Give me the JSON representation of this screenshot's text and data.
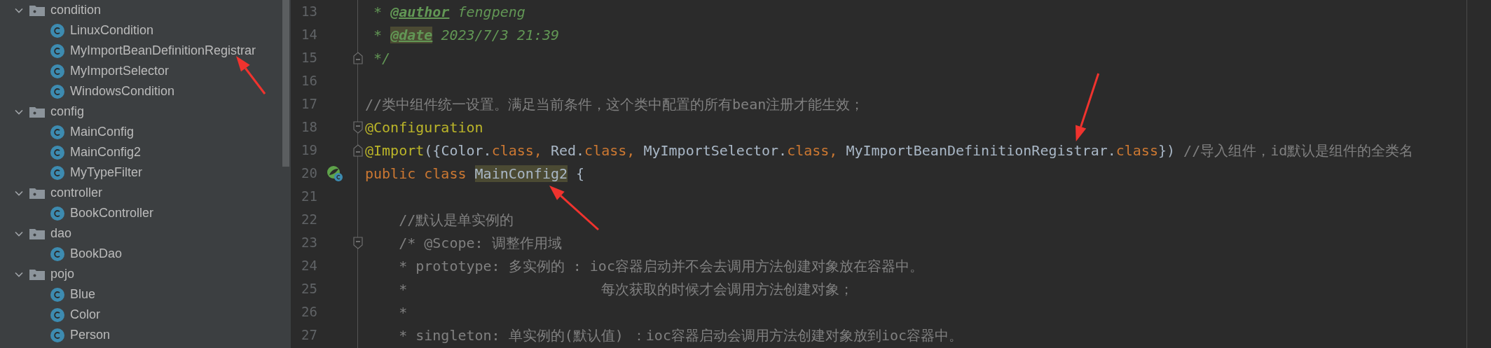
{
  "project_tree": [
    {
      "name": "condition",
      "kind": "package",
      "expanded": true,
      "children": [
        {
          "name": "LinuxCondition",
          "kind": "class"
        },
        {
          "name": "MyImportBeanDefinitionRegistrar",
          "kind": "class"
        },
        {
          "name": "MyImportSelector",
          "kind": "class"
        },
        {
          "name": "WindowsCondition",
          "kind": "class"
        }
      ]
    },
    {
      "name": "config",
      "kind": "package",
      "expanded": true,
      "children": [
        {
          "name": "MainConfig",
          "kind": "class"
        },
        {
          "name": "MainConfig2",
          "kind": "class"
        },
        {
          "name": "MyTypeFilter",
          "kind": "class"
        }
      ]
    },
    {
      "name": "controller",
      "kind": "package",
      "expanded": true,
      "children": [
        {
          "name": "BookController",
          "kind": "class"
        }
      ]
    },
    {
      "name": "dao",
      "kind": "package",
      "expanded": true,
      "children": [
        {
          "name": "BookDao",
          "kind": "class"
        }
      ]
    },
    {
      "name": "pojo",
      "kind": "package",
      "expanded": true,
      "children": [
        {
          "name": "Blue",
          "kind": "class"
        },
        {
          "name": "Color",
          "kind": "class"
        },
        {
          "name": "Person",
          "kind": "class"
        }
      ]
    }
  ],
  "editor": {
    "lines": [
      {
        "number": "13",
        "tokens": [
          {
            "text": " * ",
            "kind": "doc",
            "highlighted": false
          },
          {
            "text": "@author",
            "kind": "doctag",
            "highlighted": false
          },
          {
            "text": " fengpeng",
            "kind": "doc",
            "highlighted": false
          }
        ]
      },
      {
        "number": "14",
        "tokens": [
          {
            "text": " * ",
            "kind": "doc",
            "highlighted": false
          },
          {
            "text": "@date",
            "kind": "doctag",
            "highlighted": true
          },
          {
            "text": " 2023/7/3 21:39",
            "kind": "doc",
            "highlighted": false
          }
        ]
      },
      {
        "number": "15",
        "kind": "fold-end",
        "tokens": [
          {
            "text": " */",
            "kind": "doc",
            "highlighted": false
          }
        ]
      },
      {
        "number": "16"
      },
      {
        "number": "17",
        "tokens": [
          {
            "text": "//类中组件统一设置。满足当前条件，这个类中配置的所有bean注册才能生效；",
            "kind": "comment",
            "highlighted": false
          }
        ]
      },
      {
        "number": "18",
        "kind": "fold-start",
        "tokens": [
          {
            "text": "@Configuration",
            "kind": "annotation",
            "highlighted": false
          }
        ]
      },
      {
        "number": "19",
        "kind": "fold-end",
        "tokens": [
          {
            "text": "@Import",
            "kind": "annotation",
            "highlighted": false
          },
          {
            "text": "({Color.",
            "kind": "plain",
            "highlighted": false
          },
          {
            "text": "class",
            "kind": "keyword",
            "highlighted": false
          },
          {
            "text": ", ",
            "kind": "keyword",
            "highlighted": false
          },
          {
            "text": "Red.",
            "kind": "plain",
            "highlighted": false
          },
          {
            "text": "class",
            "kind": "keyword",
            "highlighted": false
          },
          {
            "text": ", ",
            "kind": "keyword",
            "highlighted": false
          },
          {
            "text": "MyImportSelector.",
            "kind": "plain",
            "highlighted": false
          },
          {
            "text": "class",
            "kind": "keyword",
            "highlighted": false
          },
          {
            "text": ", ",
            "kind": "keyword",
            "highlighted": false
          },
          {
            "text": "MyImportBeanDefinitionRegistrar.",
            "kind": "plain",
            "highlighted": false
          },
          {
            "text": "class",
            "kind": "keyword",
            "highlighted": false
          },
          {
            "text": "}) ",
            "kind": "plain",
            "highlighted": false
          },
          {
            "text": "//导入组件，id默认是组件的全类名",
            "kind": "comment",
            "highlighted": false
          }
        ]
      },
      {
        "number": "20",
        "kind": "bean",
        "tokens": [
          {
            "text": "public class ",
            "kind": "keyword",
            "highlighted": false
          },
          {
            "text": "MainConfig2",
            "kind": "plain",
            "highlighted": true
          },
          {
            "text": " {",
            "kind": "plain",
            "highlighted": false
          }
        ]
      },
      {
        "number": "21"
      },
      {
        "number": "22",
        "tokens": [
          {
            "text": "    //默认是单实例的",
            "kind": "comment",
            "highlighted": false
          }
        ]
      },
      {
        "number": "23",
        "kind": "fold-start",
        "tokens": [
          {
            "text": "    /* @Scope: 调整作用域",
            "kind": "comment",
            "highlighted": false
          }
        ]
      },
      {
        "number": "24",
        "tokens": [
          {
            "text": "    * prototype: 多实例的 : ioc容器启动并不会去调用方法创建对象放在容器中。",
            "kind": "comment",
            "highlighted": false
          }
        ]
      },
      {
        "number": "25",
        "tokens": [
          {
            "text": "    *                       每次获取的时候才会调用方法创建对象；",
            "kind": "comment",
            "highlighted": false
          }
        ]
      },
      {
        "number": "26",
        "tokens": [
          {
            "text": "    *",
            "kind": "comment",
            "highlighted": false
          }
        ]
      },
      {
        "number": "27",
        "tokens": [
          {
            "text": "    * singleton: 单实例的(默认值) ：ioc容器启动会调用方法创建对象放到ioc容器中。",
            "kind": "comment",
            "highlighted": false
          }
        ]
      }
    ]
  }
}
